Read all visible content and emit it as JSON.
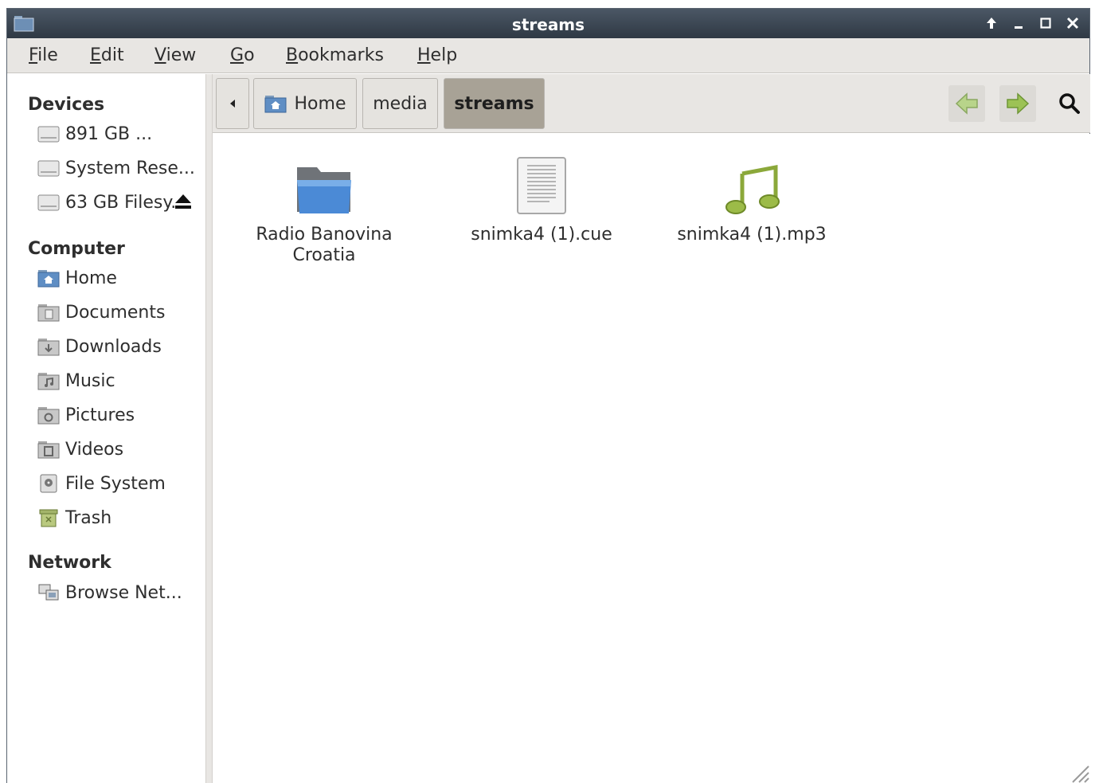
{
  "window": {
    "title": "streams"
  },
  "menubar": [
    {
      "key": "F",
      "rest": "ile"
    },
    {
      "key": "E",
      "rest": "dit"
    },
    {
      "key": "V",
      "rest": "iew"
    },
    {
      "key": "G",
      "rest": "o"
    },
    {
      "key": "B",
      "rest": "ookmarks"
    },
    {
      "key": "H",
      "rest": "elp"
    }
  ],
  "sidebar": {
    "devices_heading": "Devices",
    "devices": [
      "891 GB ...",
      "System Rese...",
      "63 GB Filesy..."
    ],
    "computer_heading": "Computer",
    "computer": [
      "Home",
      "Documents",
      "Downloads",
      "Music",
      "Pictures",
      "Videos",
      "File System",
      "Trash"
    ],
    "network_heading": "Network",
    "network": [
      "Browse Net..."
    ]
  },
  "breadcrumb": {
    "items": [
      "Home",
      "media",
      "streams"
    ],
    "active": "streams"
  },
  "files": [
    {
      "name_line1": "Radio Banovina",
      "name_line2": "Croatia",
      "type": "folder-icon"
    },
    {
      "name_line1": "snimka4 (1).cue",
      "name_line2": "",
      "type": "text-file-icon"
    },
    {
      "name_line1": "snimka4 (1).mp3",
      "name_line2": "",
      "type": "music-file-icon"
    }
  ],
  "colors": {
    "titlebar": "#39434f",
    "toolbar": "#e8e6e3",
    "active_crumb": "#a8a296",
    "nav_arrow": "#9cc255"
  }
}
